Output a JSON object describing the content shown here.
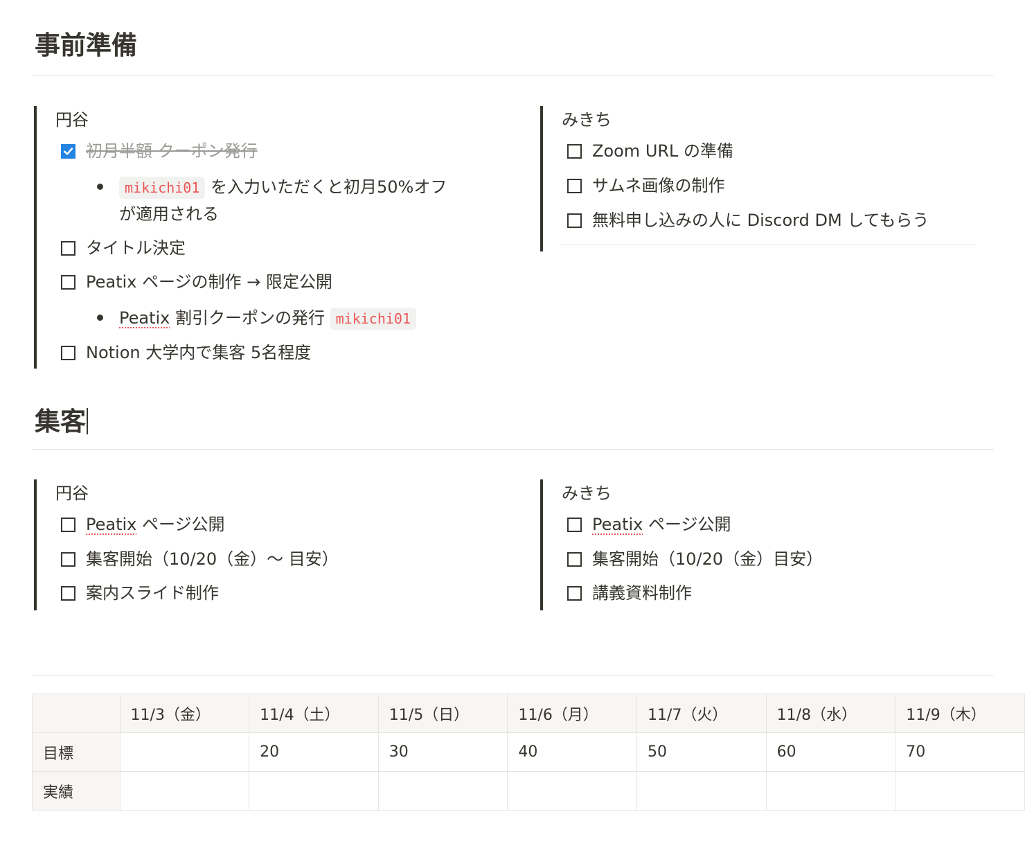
{
  "sections": [
    {
      "heading": "事前準備",
      "left": {
        "title": "円谷",
        "todo_1": "初月半額 クーポン発行",
        "bullet_1_code": "mikichi01",
        "bullet_1_text_a": " を入力いただくと初月50%オフ",
        "bullet_1_text_b": "が適用される",
        "todo_2": "タイトル決定",
        "todo_3": "Peatix ページの制作 → 限定公開",
        "bullet_2_word": "Peatix",
        "bullet_2_text": " 割引クーポンの発行 ",
        "bullet_2_code": "mikichi01",
        "todo_4": "Notion 大学内で集客 5名程度"
      },
      "right": {
        "title": "みきち",
        "todos": [
          "Zoom URL の準備",
          "サムネ画像の制作",
          "無料申し込みの人に Discord DM してもらう"
        ]
      }
    },
    {
      "heading": "集客",
      "left": {
        "title": "円谷",
        "todo_1_word": "Peatix",
        "todo_1_rest": " ページ公開",
        "todo_2": "集客開始（10/20（金）〜 目安）",
        "todo_3": "案内スライド制作"
      },
      "right": {
        "title": "みきち",
        "todo_1_word": "Peatix",
        "todo_1_rest": " ページ公開",
        "todo_2": "集客開始（10/20（金）目安）",
        "todo_3": "講義資料制作"
      }
    }
  ],
  "table": {
    "columns": [
      "",
      "11/3（金）",
      "11/4（土）",
      "11/5（日）",
      "11/6（月）",
      "11/7（火）",
      "11/8（水）",
      "11/9（木）"
    ],
    "rows": [
      {
        "label": "目標",
        "cells": [
          "",
          "20",
          "30",
          "40",
          "50",
          "60",
          "70"
        ]
      },
      {
        "label": "実績",
        "cells": [
          "",
          "",
          "",
          "",
          "",
          "",
          ""
        ]
      }
    ]
  },
  "colors": {
    "text": "#37352f",
    "check_blue": "#2383e2",
    "code_red": "#eb5757",
    "done_gray": "#9b9a97"
  }
}
